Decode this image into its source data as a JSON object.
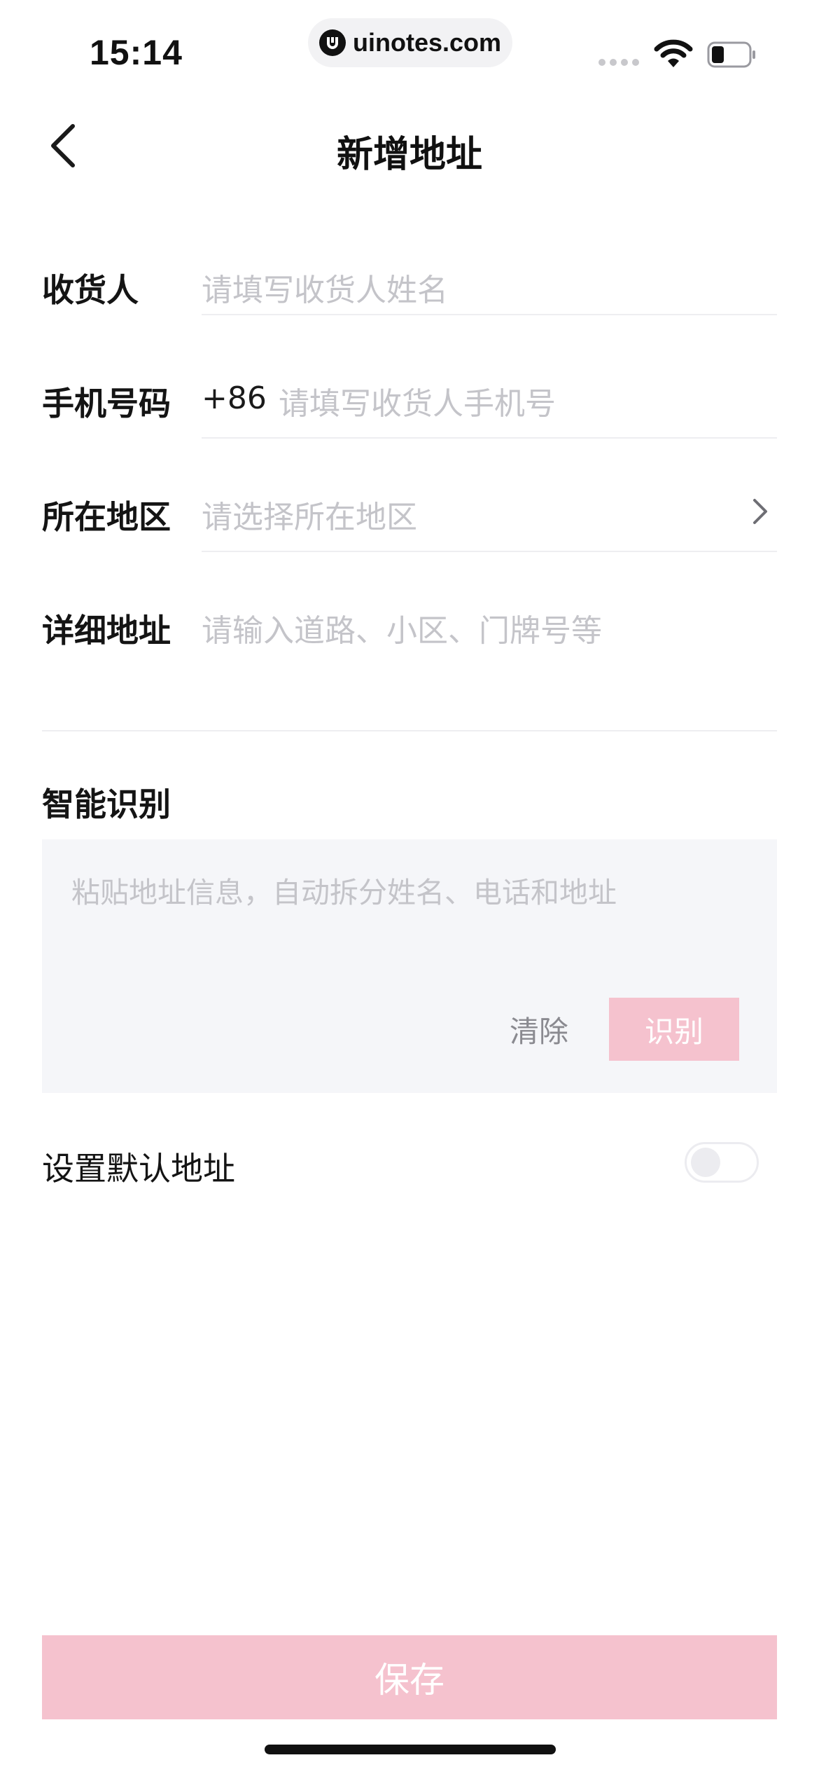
{
  "status_bar": {
    "time": "15:14",
    "url": "uinotes.com"
  },
  "header": {
    "title": "新增地址"
  },
  "form": {
    "recipient": {
      "label": "收货人",
      "placeholder": "请填写收货人姓名"
    },
    "phone": {
      "label": "手机号码",
      "prefix": "+86",
      "placeholder": "请填写收货人手机号"
    },
    "region": {
      "label": "所在地区",
      "placeholder": "请选择所在地区"
    },
    "detail": {
      "label": "详细地址",
      "placeholder": "请输入道路、小区、门牌号等"
    }
  },
  "smart": {
    "title": "智能识别",
    "placeholder": "粘贴地址信息，自动拆分姓名、电话和地址",
    "clear_label": "清除",
    "identify_label": "识别"
  },
  "default_address": {
    "label": "设置默认地址",
    "enabled": false
  },
  "footer": {
    "save_label": "保存"
  },
  "colors": {
    "accent_disabled": "#f5c2ce",
    "placeholder": "#c4c4c9"
  }
}
